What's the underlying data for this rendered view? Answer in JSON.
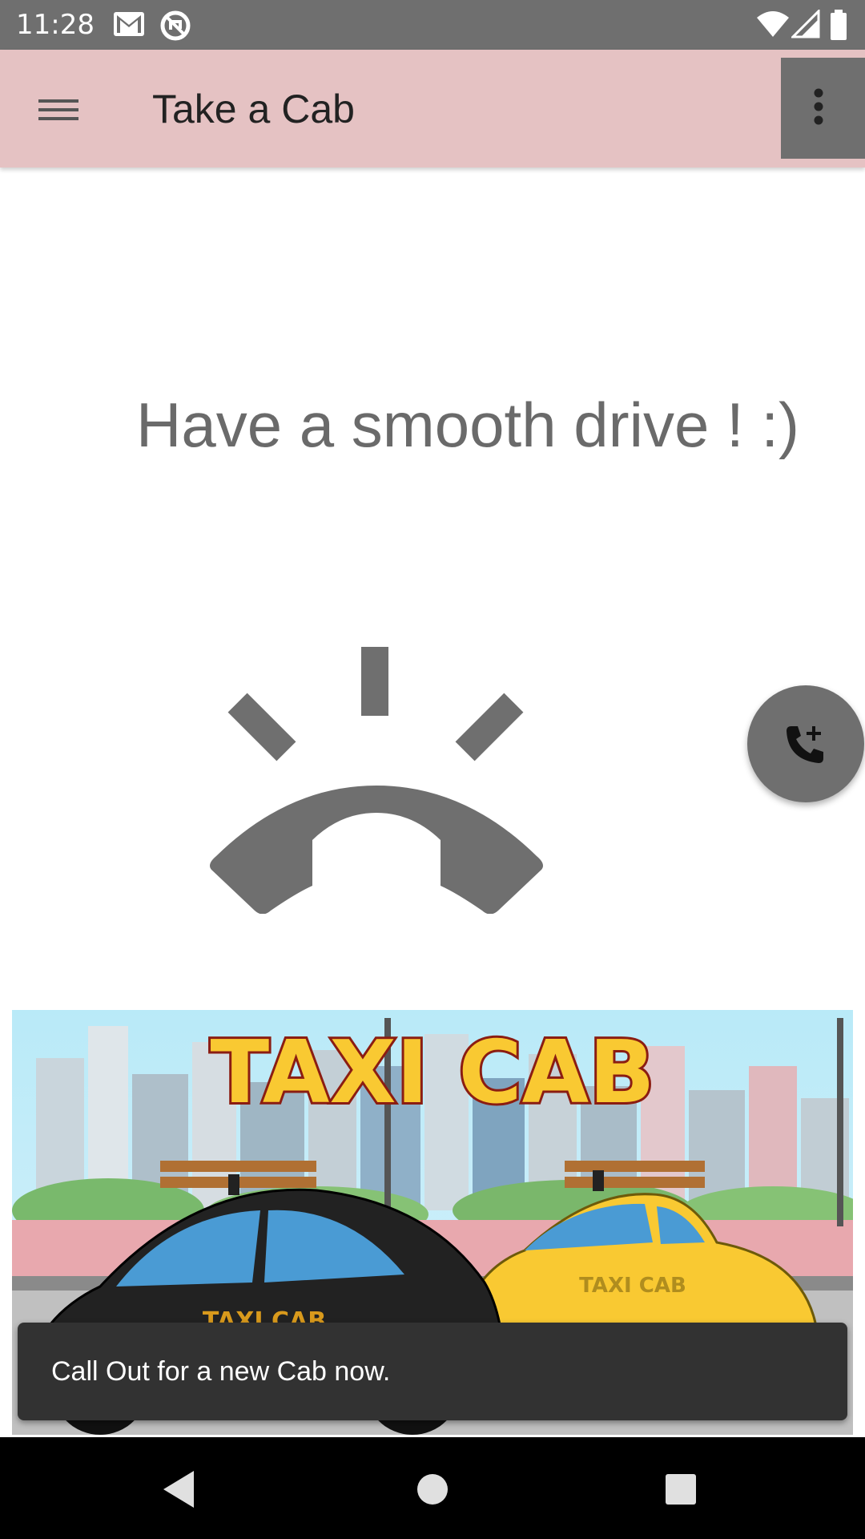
{
  "status_bar": {
    "time": "11:28",
    "icons": [
      "gmail-icon",
      "no-sim-data-icon",
      "wifi-icon",
      "signal-icon",
      "battery-icon"
    ]
  },
  "app_bar": {
    "title": "Take a Cab",
    "background_color": "#e5c2c3"
  },
  "main": {
    "tagline": "Have a smooth drive ! :)",
    "illustration": "ringing-phone-icon",
    "fab_icon": "add-call-icon"
  },
  "banner": {
    "headline": "TAXI CAB",
    "car_label": "TAXI CAB"
  },
  "snackbar": {
    "message": "Call Out for a new Cab now."
  },
  "nav_bar": {
    "buttons": [
      "back-icon",
      "home-icon",
      "recents-icon"
    ]
  },
  "colors": {
    "status_bar": "#6f6f6f",
    "accent_gray": "#6f6f6f",
    "snackbar": "#323232",
    "taxi_yellow": "#f9c932"
  }
}
